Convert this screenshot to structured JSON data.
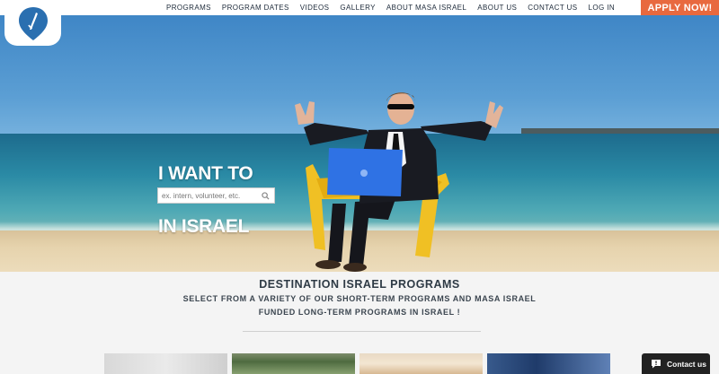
{
  "nav": {
    "items": [
      "PROGRAMS",
      "PROGRAM DATES",
      "VIDEOS",
      "GALLERY",
      "ABOUT MASA ISRAEL",
      "ABOUT US",
      "CONTACT US",
      "LOG IN"
    ],
    "apply_label": "APPLY NOW!"
  },
  "hero": {
    "line1": "I WANT TO",
    "line2": "IN ISRAEL",
    "search_placeholder": "ex. intern, volunteer, etc."
  },
  "section": {
    "title": "DESTINATION ISRAEL PROGRAMS",
    "subtitle_line1": "SELECT FROM A VARIETY OF OUR SHORT-TERM PROGRAMS AND MASA ISRAEL",
    "subtitle_line2": "FUNDED LONG-TERM   PROGRAMS IN ISRAEL  !"
  },
  "contact": {
    "label": "Contact us"
  },
  "colors": {
    "accent": "#e8693f",
    "brand": "#2a6fb0"
  }
}
